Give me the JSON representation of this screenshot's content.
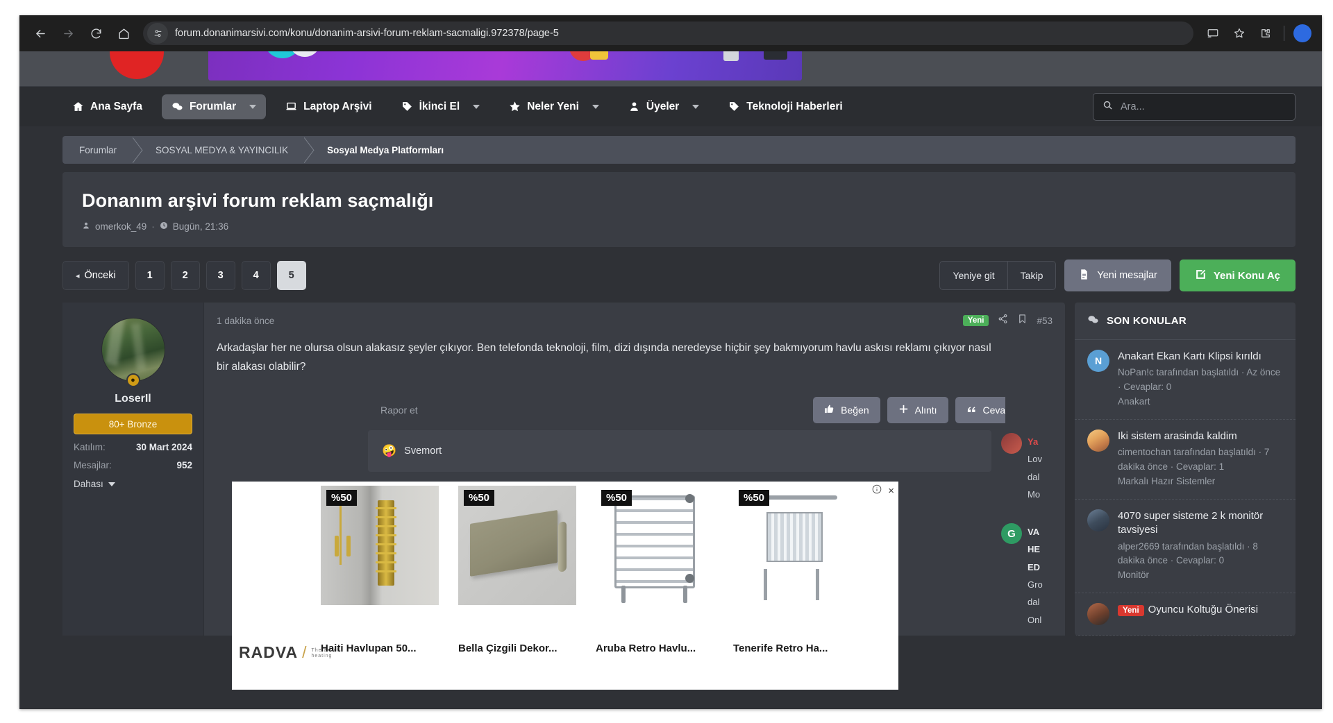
{
  "browser": {
    "url": "forum.donanimarsivi.com/konu/donanim-arsivi-forum-reklam-sacmaligi.972378/page-5",
    "back_label": "Back",
    "forward_label": "Forward",
    "reload_label": "Reload",
    "home_label": "Home",
    "site_info_label": "View site information",
    "cast_label": "Cast",
    "bookmark_label": "Bookmark this tab",
    "extensions_label": "Extensions",
    "profile_initial": ""
  },
  "sitenav": {
    "items": [
      {
        "label": "Ana Sayfa",
        "icon": "home-icon",
        "has_caret": false,
        "active": false
      },
      {
        "label": "Forumlar",
        "icon": "chat-icon",
        "has_caret": true,
        "active": true
      },
      {
        "label": "Laptop Arşivi",
        "icon": "laptop-icon",
        "has_caret": false,
        "active": false
      },
      {
        "label": "İkinci El",
        "icon": "tag-icon",
        "has_caret": true,
        "active": false
      },
      {
        "label": "Neler Yeni",
        "icon": "star-icon",
        "has_caret": true,
        "active": false
      },
      {
        "label": "Üyeler",
        "icon": "user-icon",
        "has_caret": true,
        "active": false
      },
      {
        "label": "Teknoloji Haberleri",
        "icon": "tag-icon",
        "has_caret": false,
        "active": false
      }
    ],
    "search_placeholder": "Ara..."
  },
  "breadcrumb": {
    "items": [
      "Forumlar",
      "SOSYAL MEDYA & YAYINCILIK",
      "Sosyal Medya Platformları"
    ]
  },
  "thread": {
    "title": "Donanım arşivi forum reklam saçmalığı",
    "author": "omerkok_49",
    "separator": "·",
    "date": "Bugün, 21:36"
  },
  "pagination": {
    "prev_label": "Önceki",
    "prev_arrow": "◂",
    "pages": [
      "1",
      "2",
      "3",
      "4",
      "5"
    ],
    "current": "5",
    "goto_new_label": "Yeniye git",
    "follow_label": "Takip",
    "new_messages_label": "Yeni mesajlar",
    "new_thread_label": "Yeni Konu Aç"
  },
  "post": {
    "time": "1 dakika önce",
    "new_badge": "Yeni",
    "number": "#53",
    "body": "Arkadaşlar her ne olursa olsun alakasız şeyler çıkıyor. Ben telefonda teknoloji, film, dizi dışında neredeyse hiçbir şey bakmıyorum havlu askısı reklamı çıkıyor nasıl bir alakası olabilir?",
    "report_label": "Rapor et",
    "like_label": "Beğen",
    "quote_label": "Alıntı",
    "reply_label": "Cevap",
    "signature_emoji": "🤪",
    "signature_name": "Svemort",
    "user": {
      "name": "LoserIl",
      "rank": "80+ Bronze",
      "joined_label": "Katılım:",
      "joined_value": "30 Mart 2024",
      "messages_label": "Mesajlar:",
      "messages_value": "952",
      "more_label": "Dahası"
    }
  },
  "ad": {
    "brand": "RADVA",
    "brand_slash": "/",
    "brand_tagline_line1": "The art of",
    "brand_tagline_line2": "heating",
    "info_label": "Ad info",
    "close_label": "×",
    "products": [
      {
        "discount": "%50",
        "title": "Haiti Havlupan 50..."
      },
      {
        "discount": "%50",
        "title": "Bella Çizgili Dekor..."
      },
      {
        "discount": "%50",
        "title": "Aruba Retro Havlu..."
      },
      {
        "discount": "%50",
        "title": "Tenerife Retro Ha..."
      }
    ]
  },
  "mini_replies": [
    {
      "name": "Ya",
      "line1": "Lov",
      "line2": "dal",
      "line3": "Mo",
      "avatar": "red"
    },
    {
      "name": "VA",
      "line1": "HE",
      "line2": "ED",
      "line3": "Gro",
      "line4": "dal",
      "line5": "Onl",
      "avatar": "green",
      "initial": "G"
    }
  ],
  "sidebar": {
    "header": "SON KONULAR",
    "items": [
      {
        "title": "Anakart Ekan Kartı Klipsi kırıldı",
        "sub": "NoPan!c tarafından başlatıldı · Az önce · Cevaplar: 0",
        "node": "Anakart",
        "avatar": "initial",
        "initial": "N",
        "badge": ""
      },
      {
        "title": "Iki sistem arasinda kaldim",
        "sub": "cimentochan tarafından başlatıldı · 7 dakika önce · Cevaplar: 1",
        "node": "Markalı Hazır Sistemler",
        "avatar": "anime",
        "initial": "",
        "badge": ""
      },
      {
        "title": "4070 super sisteme 2 k monitör tavsiyesi",
        "sub": "alper2669 tarafından başlatıldı · 8 dakika önce · Cevaplar: 0",
        "node": "Monitör",
        "avatar": "photo",
        "initial": "",
        "badge": ""
      },
      {
        "title": "Oyuncu Koltuğu Önerisi",
        "sub": "",
        "node": "",
        "avatar": "photo2",
        "initial": "",
        "badge": "Yeni"
      }
    ]
  }
}
